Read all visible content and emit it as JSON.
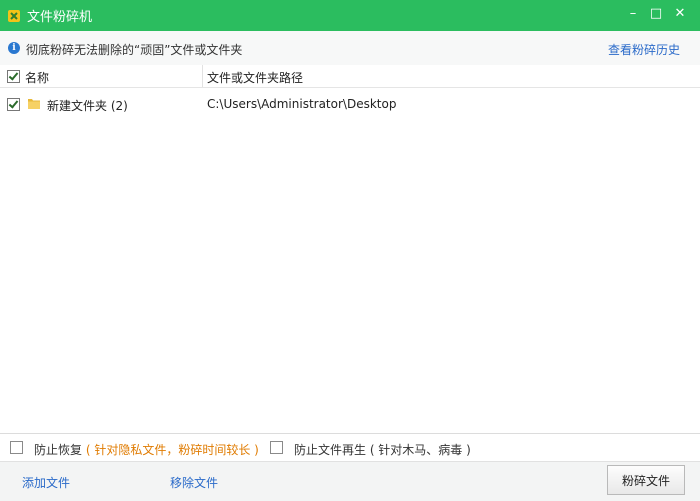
{
  "titlebar": {
    "title": "文件粉碎机",
    "minimize": "–",
    "maximize": "□",
    "close": "✕"
  },
  "infobar": {
    "message": "彻底粉碎无法删除的“顽固”文件或文件夹",
    "history_link": "查看粉碎历史"
  },
  "table": {
    "header_name": "名称",
    "header_path": "文件或文件夹路径",
    "rows": [
      {
        "name": "新建文件夹 (2)",
        "path": "C:\\Users\\Administrator\\Desktop",
        "checked": true
      }
    ]
  },
  "options": {
    "prevent_recovery_label": "防止恢复",
    "prevent_recovery_note": "( 针对隐私文件，粉碎时间较长 )",
    "prevent_regen_label": "防止文件再生 ( 针对木马、病毒 )"
  },
  "footer": {
    "add_files": "添加文件",
    "remove_files": "移除文件",
    "shred_button": "粉碎文件"
  },
  "colors": {
    "titlebar": "#2bbd5f",
    "link": "#2a6ac9",
    "note_orange": "#e07b00"
  },
  "icons": {
    "logo": "shredder-logo-icon",
    "info": "info-icon",
    "folder": "folder-icon"
  }
}
